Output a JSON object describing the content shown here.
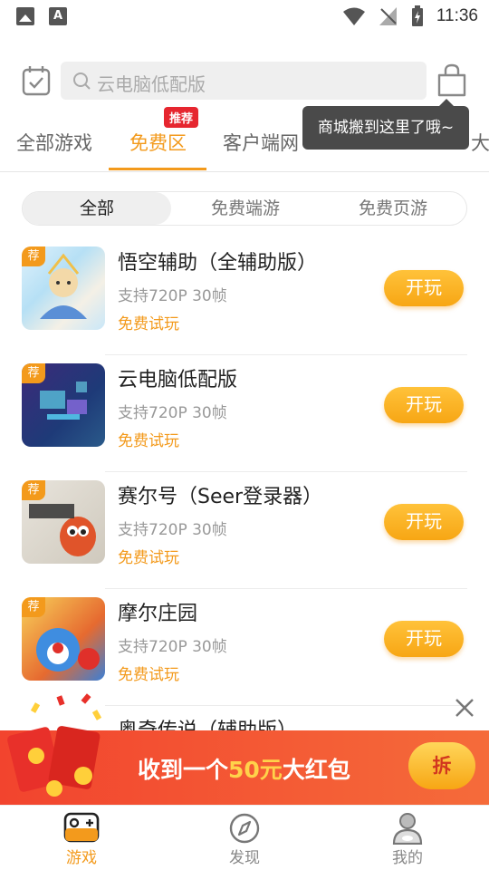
{
  "status_bar": {
    "time": "11:36"
  },
  "search": {
    "placeholder": "云电脑低配版"
  },
  "tabs": [
    {
      "label": "全部游戏"
    },
    {
      "label": "免费区",
      "badge": "推荐"
    },
    {
      "label": "客户端网"
    },
    {
      "label": "大"
    }
  ],
  "tooltip": "商城搬到这里了哦~",
  "segments": [
    "全部",
    "免费端游",
    "免费页游"
  ],
  "games": [
    {
      "badge": "荐",
      "title": "悟空辅助（全辅助版）",
      "spec": "支持720P 30帧",
      "free": "免费试玩",
      "action": "开玩"
    },
    {
      "badge": "荐",
      "title": "云电脑低配版",
      "spec": "支持720P 30帧",
      "free": "免费试玩",
      "action": "开玩"
    },
    {
      "badge": "荐",
      "title": "赛尔号（Seer登录器）",
      "spec": "支持720P 30帧",
      "free": "免费试玩",
      "action": "开玩"
    },
    {
      "badge": "荐",
      "title": "摩尔庄园",
      "spec": "支持720P 30帧",
      "free": "免费试玩",
      "action": "开玩"
    },
    {
      "title": "奥奇传说（辅助版）"
    }
  ],
  "banner": {
    "prefix": "收到一个",
    "amount": "50元",
    "suffix": "大红包",
    "button": "拆"
  },
  "bottom_nav": [
    {
      "label": "游戏",
      "icon": "gamepad-icon"
    },
    {
      "label": "发现",
      "icon": "compass-icon"
    },
    {
      "label": "我的",
      "icon": "user-icon"
    }
  ],
  "colors": {
    "accent": "#f39a1c",
    "badge_red": "#e6262f",
    "banner_red": "#f2442e"
  }
}
